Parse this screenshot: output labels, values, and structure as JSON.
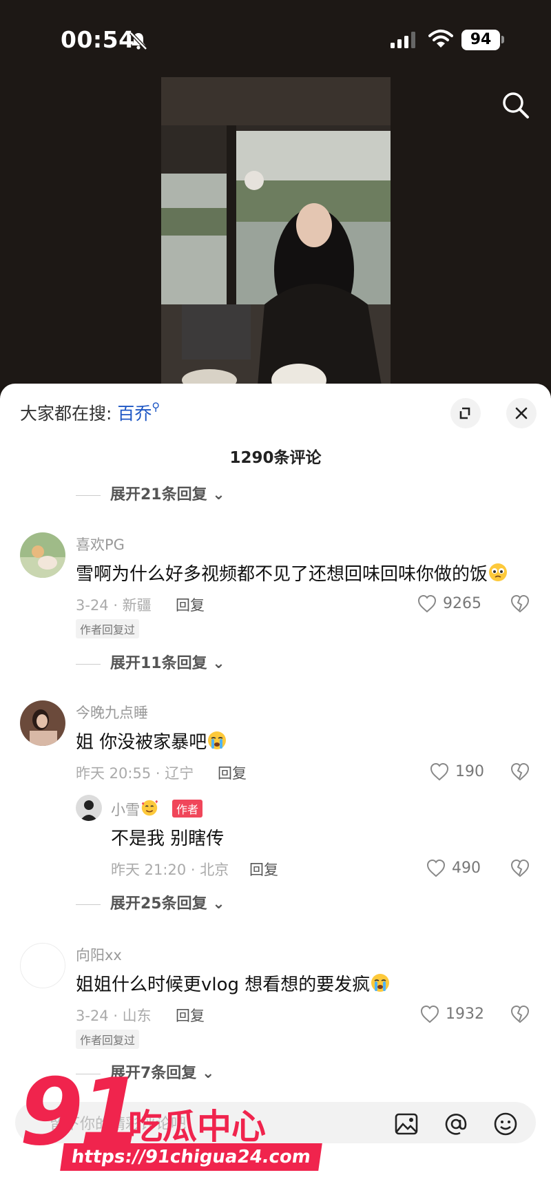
{
  "status_bar": {
    "time": "00:54",
    "battery": "94"
  },
  "sheet": {
    "hot_search_prefix": "大家都在搜:",
    "hot_search_term": "百乔",
    "comment_count": "1290条评论",
    "expand_top": "展开21条回复",
    "comments": [
      {
        "username": "喜欢PG",
        "text": "雪啊为什么好多视频都不见了还想回味回味你做的饭",
        "date_loc": "3-24 · 新疆",
        "reply": "回复",
        "likes": "9265",
        "tag": "作者回复过",
        "expand": "展开11条回复"
      },
      {
        "username": "今晚九点睡",
        "text": "姐 你没被家暴吧",
        "date_loc": "昨天 20:55 · 辽宁",
        "reply": "回复",
        "likes": "190",
        "sub_reply": {
          "username": "小雪",
          "author_tag": "作者",
          "text": "不是我 别瞎传",
          "date_loc": "昨天 21:20 · 北京",
          "reply": "回复",
          "likes": "490"
        },
        "expand": "展开25条回复"
      },
      {
        "username": "向阳xx",
        "text": "姐姐什么时候更vlog  想看想的要发疯",
        "date_loc": "3-24 · 山东",
        "reply": "回复",
        "likes": "1932",
        "tag": "作者回复过",
        "expand": "展开7条回复"
      }
    ]
  },
  "input": {
    "placeholder": "留下你的精彩评论吧"
  },
  "watermark": {
    "number": "91",
    "text": "吃瓜中心",
    "url": "https://91chigua24.com"
  },
  "colors": {
    "accent_link": "#1d56c4",
    "author_tag": "#f0465a",
    "watermark": "#f0244d"
  },
  "icons": [
    "bell-muted-icon",
    "signal-icon",
    "wifi-icon",
    "search-icon",
    "expand-icon",
    "close-icon",
    "heart-icon",
    "dislike-icon",
    "image-icon",
    "at-icon",
    "emoji-icon"
  ]
}
